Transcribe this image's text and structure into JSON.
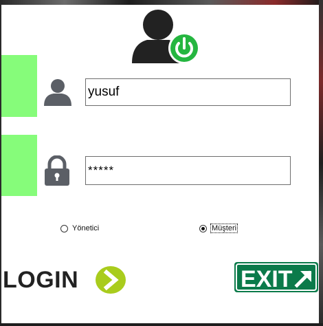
{
  "form": {
    "username_value": "yusuf",
    "password_value": "*****"
  },
  "roles": {
    "option1_label": "Yönetici",
    "option2_label": "Müşteri",
    "selected": "Müşteri"
  },
  "buttons": {
    "login_label": "LOGIN",
    "exit_label": "EXIT"
  },
  "icons": {
    "header": "user-power-icon",
    "username": "user-icon",
    "password": "lock-icon",
    "login_arrow": "chevron-right-icon",
    "exit_arrow": "arrow-up-right-icon"
  },
  "colors": {
    "accent_green": "#86fc7a",
    "power_green": "#25b640",
    "login_arrow_green": "#a9cc1d",
    "exit_sign_green": "#0b7a4a"
  }
}
